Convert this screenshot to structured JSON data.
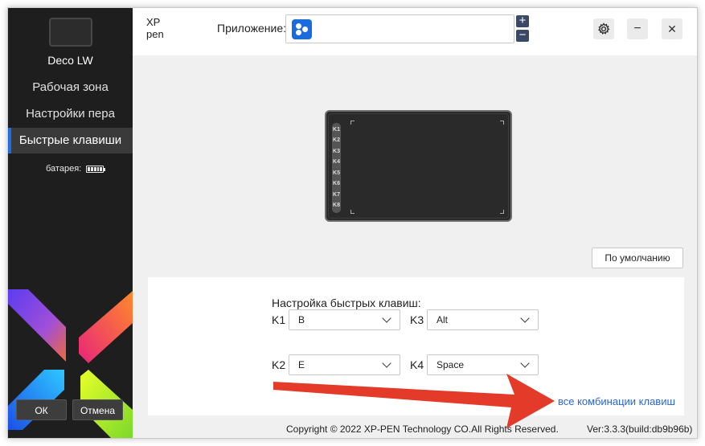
{
  "device": {
    "name": "Deco LW"
  },
  "sidebar": {
    "items": [
      {
        "label": "Рабочая зона",
        "active": false
      },
      {
        "label": "Настройки пера",
        "active": false
      },
      {
        "label": "Быстрые клавиши",
        "active": true
      }
    ],
    "battery_label": "батарея:",
    "ok_label": "ОК",
    "cancel_label": "Отмена"
  },
  "header": {
    "logo_text_top": "XP",
    "logo_text_bottom": "pen",
    "app_label": "Приложение:",
    "plus_label": "+",
    "minus_label": "−",
    "minimize_label": "−",
    "close_label": "✕"
  },
  "tablet": {
    "keys": [
      "K1",
      "K2",
      "K3",
      "K4",
      "K5",
      "K6",
      "K7",
      "K8"
    ]
  },
  "default_button_label": "По умолчанию",
  "shortcuts": {
    "title": "Настройка быстрых клавиш:",
    "keys": [
      {
        "name": "K1",
        "value": "B"
      },
      {
        "name": "K3",
        "value": "Alt"
      },
      {
        "name": "K2",
        "value": "E"
      },
      {
        "name": "K4",
        "value": "Space"
      }
    ],
    "all_combos_link": "все комбинации клавиш"
  },
  "footer": {
    "copyright": "Copyright © 2022  XP-PEN Technology CO.All Rights Reserved.",
    "version": "Ver:3.3.3(build:db9b96b)"
  },
  "colors": {
    "accent": "#1d6fe0",
    "sidebar_bg": "#1e1e1e",
    "link": "#2a66d4",
    "annotation_arrow": "#e43a2a"
  }
}
